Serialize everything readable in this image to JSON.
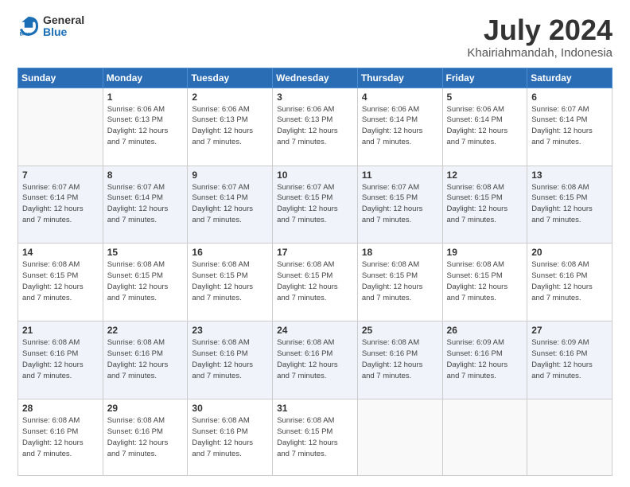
{
  "logo": {
    "general": "General",
    "blue": "Blue"
  },
  "title": {
    "month_year": "July 2024",
    "location": "Khairiahmandah, Indonesia"
  },
  "weekdays": [
    "Sunday",
    "Monday",
    "Tuesday",
    "Wednesday",
    "Thursday",
    "Friday",
    "Saturday"
  ],
  "weeks": [
    [
      {
        "day": "",
        "info": ""
      },
      {
        "day": "1",
        "info": "Sunrise: 6:06 AM\nSunset: 6:13 PM\nDaylight: 12 hours\nand 7 minutes."
      },
      {
        "day": "2",
        "info": "Sunrise: 6:06 AM\nSunset: 6:13 PM\nDaylight: 12 hours\nand 7 minutes."
      },
      {
        "day": "3",
        "info": "Sunrise: 6:06 AM\nSunset: 6:13 PM\nDaylight: 12 hours\nand 7 minutes."
      },
      {
        "day": "4",
        "info": "Sunrise: 6:06 AM\nSunset: 6:14 PM\nDaylight: 12 hours\nand 7 minutes."
      },
      {
        "day": "5",
        "info": "Sunrise: 6:06 AM\nSunset: 6:14 PM\nDaylight: 12 hours\nand 7 minutes."
      },
      {
        "day": "6",
        "info": "Sunrise: 6:07 AM\nSunset: 6:14 PM\nDaylight: 12 hours\nand 7 minutes."
      }
    ],
    [
      {
        "day": "7",
        "info": "Sunrise: 6:07 AM\nSunset: 6:14 PM\nDaylight: 12 hours\nand 7 minutes."
      },
      {
        "day": "8",
        "info": "Sunrise: 6:07 AM\nSunset: 6:14 PM\nDaylight: 12 hours\nand 7 minutes."
      },
      {
        "day": "9",
        "info": "Sunrise: 6:07 AM\nSunset: 6:14 PM\nDaylight: 12 hours\nand 7 minutes."
      },
      {
        "day": "10",
        "info": "Sunrise: 6:07 AM\nSunset: 6:15 PM\nDaylight: 12 hours\nand 7 minutes."
      },
      {
        "day": "11",
        "info": "Sunrise: 6:07 AM\nSunset: 6:15 PM\nDaylight: 12 hours\nand 7 minutes."
      },
      {
        "day": "12",
        "info": "Sunrise: 6:08 AM\nSunset: 6:15 PM\nDaylight: 12 hours\nand 7 minutes."
      },
      {
        "day": "13",
        "info": "Sunrise: 6:08 AM\nSunset: 6:15 PM\nDaylight: 12 hours\nand 7 minutes."
      }
    ],
    [
      {
        "day": "14",
        "info": "Sunrise: 6:08 AM\nSunset: 6:15 PM\nDaylight: 12 hours\nand 7 minutes."
      },
      {
        "day": "15",
        "info": "Sunrise: 6:08 AM\nSunset: 6:15 PM\nDaylight: 12 hours\nand 7 minutes."
      },
      {
        "day": "16",
        "info": "Sunrise: 6:08 AM\nSunset: 6:15 PM\nDaylight: 12 hours\nand 7 minutes."
      },
      {
        "day": "17",
        "info": "Sunrise: 6:08 AM\nSunset: 6:15 PM\nDaylight: 12 hours\nand 7 minutes."
      },
      {
        "day": "18",
        "info": "Sunrise: 6:08 AM\nSunset: 6:15 PM\nDaylight: 12 hours\nand 7 minutes."
      },
      {
        "day": "19",
        "info": "Sunrise: 6:08 AM\nSunset: 6:15 PM\nDaylight: 12 hours\nand 7 minutes."
      },
      {
        "day": "20",
        "info": "Sunrise: 6:08 AM\nSunset: 6:16 PM\nDaylight: 12 hours\nand 7 minutes."
      }
    ],
    [
      {
        "day": "21",
        "info": "Sunrise: 6:08 AM\nSunset: 6:16 PM\nDaylight: 12 hours\nand 7 minutes."
      },
      {
        "day": "22",
        "info": "Sunrise: 6:08 AM\nSunset: 6:16 PM\nDaylight: 12 hours\nand 7 minutes."
      },
      {
        "day": "23",
        "info": "Sunrise: 6:08 AM\nSunset: 6:16 PM\nDaylight: 12 hours\nand 7 minutes."
      },
      {
        "day": "24",
        "info": "Sunrise: 6:08 AM\nSunset: 6:16 PM\nDaylight: 12 hours\nand 7 minutes."
      },
      {
        "day": "25",
        "info": "Sunrise: 6:08 AM\nSunset: 6:16 PM\nDaylight: 12 hours\nand 7 minutes."
      },
      {
        "day": "26",
        "info": "Sunrise: 6:09 AM\nSunset: 6:16 PM\nDaylight: 12 hours\nand 7 minutes."
      },
      {
        "day": "27",
        "info": "Sunrise: 6:09 AM\nSunset: 6:16 PM\nDaylight: 12 hours\nand 7 minutes."
      }
    ],
    [
      {
        "day": "28",
        "info": "Sunrise: 6:08 AM\nSunset: 6:16 PM\nDaylight: 12 hours\nand 7 minutes."
      },
      {
        "day": "29",
        "info": "Sunrise: 6:08 AM\nSunset: 6:16 PM\nDaylight: 12 hours\nand 7 minutes."
      },
      {
        "day": "30",
        "info": "Sunrise: 6:08 AM\nSunset: 6:16 PM\nDaylight: 12 hours\nand 7 minutes."
      },
      {
        "day": "31",
        "info": "Sunrise: 6:08 AM\nSunset: 6:15 PM\nDaylight: 12 hours\nand 7 minutes."
      },
      {
        "day": "",
        "info": ""
      },
      {
        "day": "",
        "info": ""
      },
      {
        "day": "",
        "info": ""
      }
    ]
  ]
}
